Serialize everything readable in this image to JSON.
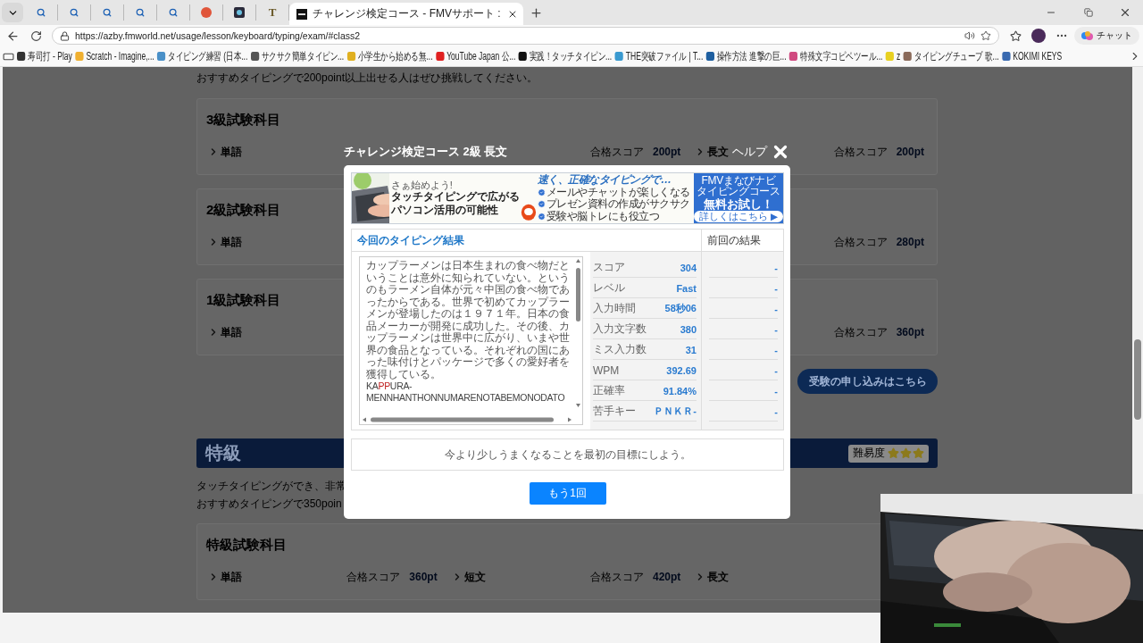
{
  "browser": {
    "tabs": [
      {
        "kind": "search",
        "selected": false
      },
      {
        "kind": "search",
        "selected": false
      },
      {
        "kind": "search",
        "selected": false
      },
      {
        "kind": "search",
        "selected": false
      },
      {
        "kind": "search",
        "selected": false
      },
      {
        "kind": "ball",
        "selected": false
      },
      {
        "kind": "app",
        "selected": false
      },
      {
        "kind": "letter",
        "glyph": "T",
        "selected": false
      },
      {
        "kind": "page",
        "title": "チャレンジ検定コース - FMVサポート :",
        "selected": true
      }
    ],
    "url": "https://azby.fmworld.net/usage/lesson/keyboard/typing/exam/#class2",
    "chat_label": "チャット",
    "bookmarks": [
      {
        "label": "寿司打 - Play",
        "color": "#333333"
      },
      {
        "label": "Scratch - Imagine,...",
        "color": "#f0b030"
      },
      {
        "label": "タイピング練習 (日本...",
        "color": "#4a90c8"
      },
      {
        "label": "サクサク簡単タイピン...",
        "color": "#555555"
      },
      {
        "label": "小学生から始める無...",
        "color": "#e0b020"
      },
      {
        "label": "YouTube Japan 公...",
        "color": "#e02020"
      },
      {
        "label": "実践！タッチタイピン...",
        "color": "#111111"
      },
      {
        "label": "THE突破ファイル | T...",
        "color": "#3a9ad0"
      },
      {
        "label": "操作方法 進撃の巨...",
        "color": "#1f5fa0"
      },
      {
        "label": "特殊文字コピペツール...",
        "color": "#d04a80"
      },
      {
        "label": "z",
        "color": "#e8d020"
      },
      {
        "label": "タイピングチューブ 歌...",
        "color": "#8a6a5a"
      },
      {
        "label": "KOKIMI KEYS",
        "color": "#3a6ab0"
      }
    ]
  },
  "page": {
    "intro": "おすすめタイピングで200point以上出せる人はぜひ挑戦してください。",
    "cards": [
      {
        "title": "3級試験科目",
        "subjects": [
          {
            "kind": "name",
            "name": "単語"
          },
          {
            "kind": "score",
            "score_label": "合格スコア",
            "score": "200pt"
          },
          {
            "kind": "full",
            "name": "長文",
            "score_label": "合格スコア",
            "score": "200pt"
          }
        ]
      },
      {
        "title": "2級試験科目",
        "subjects": [
          {
            "kind": "name",
            "name": "単語"
          },
          {
            "kind": "blank"
          },
          {
            "kind": "score",
            "score_label": "合格スコア",
            "score": "280pt"
          }
        ]
      },
      {
        "title": "1級試験科目",
        "subjects": [
          {
            "kind": "name",
            "name": "単語"
          },
          {
            "kind": "blank"
          },
          {
            "kind": "score",
            "score_label": "合格スコア",
            "score": "360pt"
          }
        ]
      }
    ],
    "apply_button": "受験の申し込みはこちら",
    "special": {
      "title": "特級",
      "difficulty_label": "難易度",
      "stars": 3,
      "description_lines": [
        "タッチタイピングができ、非常",
        "おすすめタイピングで350poin"
      ],
      "card": {
        "title": "特級試験科目",
        "subjects": [
          {
            "kind": "full",
            "name": "単語",
            "score_label": "合格スコア",
            "score": "360pt"
          },
          {
            "kind": "full",
            "name": "短文",
            "score_label": "合格スコア",
            "score": "420pt"
          },
          {
            "kind": "name",
            "name": "長文"
          }
        ]
      }
    }
  },
  "modal": {
    "title": "チャレンジ検定コース 2級 長文",
    "help": "ヘルプ",
    "ad": {
      "tagline": "さぁ始めよう!",
      "headline_lines": [
        "タッチタイピングで広がる",
        "パソコン活用の可能性"
      ],
      "lead": "速く、正確なタイピングで…",
      "points": [
        "メールやチャットが楽しくなる",
        "プレゼン資料の作成がサクサク",
        "受験や脳トレにも役立つ"
      ],
      "brand": "FMVまなびナビ",
      "course": "タイピングコース",
      "offer": "無料お試し！",
      "more": "詳しくはこちら ▶"
    },
    "results": {
      "current_heading": "今回のタイピング結果",
      "previous_heading": "前回の結果",
      "passage": "カップラーメンは日本生まれの食べ物だということは意外に知られていない。というのもラーメン自体が元々中国の食べ物であったからである。世界で初めてカップラーメンが登場したのは１９７１年。日本の食品メーカーが開発に成功した。その後、カップラーメンは世界中に広がり、いまや世界の食品となっている。それぞれの国にあった味付けとパッケージで多くの愛好者を獲得している。",
      "romaji_lines": [
        [
          {
            "text": "KA",
            "miss": false
          },
          {
            "text": "PP",
            "miss": true
          },
          {
            "text": "URA-",
            "miss": false
          }
        ],
        [
          {
            "text": "MENNHANTHONNUMARENOTABEMONODATO",
            "miss": false
          }
        ]
      ],
      "stats": [
        {
          "label": "スコア",
          "value": "304",
          "previous": "-"
        },
        {
          "label": "レベル",
          "value": "Fast",
          "previous": "-"
        },
        {
          "label": "入力時間",
          "value": "58秒06",
          "previous": "-"
        },
        {
          "label": "入力文字数",
          "value": "380",
          "previous": "-"
        },
        {
          "label": "ミス入力数",
          "value": "31",
          "previous": "-"
        },
        {
          "label": "WPM",
          "value": "392.69",
          "previous": "-"
        },
        {
          "label": "正確率",
          "value": "91.84%",
          "previous": "-"
        },
        {
          "label": "苦手キー",
          "value": "ＰＮＫＲ-",
          "previous": "-"
        }
      ]
    },
    "advice": "今より少しうまくなることを最初の目標にしよう。",
    "retry_button": "もう1回"
  }
}
